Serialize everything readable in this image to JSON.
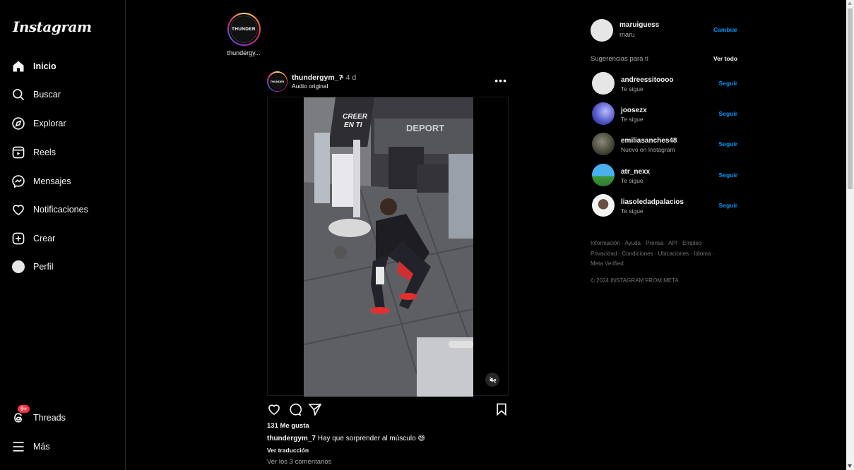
{
  "app": {
    "logo": "Instagram"
  },
  "sidebar": {
    "items": [
      {
        "label": "Inicio",
        "icon": "home-icon"
      },
      {
        "label": "Buscar",
        "icon": "search-icon"
      },
      {
        "label": "Explorar",
        "icon": "compass-icon"
      },
      {
        "label": "Reels",
        "icon": "reels-icon"
      },
      {
        "label": "Mensajes",
        "icon": "messenger-icon"
      },
      {
        "label": "Notificaciones",
        "icon": "heart-icon"
      },
      {
        "label": "Crear",
        "icon": "plus-square-icon"
      },
      {
        "label": "Perfil",
        "icon": "avatar"
      }
    ],
    "threads": {
      "label": "Threads",
      "icon": "threads-icon",
      "badge": "9+"
    },
    "more": {
      "label": "Más",
      "icon": "hamburger-icon"
    }
  },
  "story": {
    "username": "thundergy...",
    "logo_text": "THUNDER"
  },
  "post": {
    "username": "thundergym_7",
    "time": "• 4 d",
    "audio": "Audio original",
    "more": "•••",
    "avatar_text": "THUNDER",
    "likes": "131 Me gusta",
    "caption_user": "thundergym_7",
    "caption_text": "Hay que sorprender al músculo 😅",
    "translate": "Ver traducción",
    "comments": "Ver los 3 comentarios",
    "video_sign_1": "CREER",
    "video_sign_2": "EN TI",
    "video_sign_3": "DEPORT"
  },
  "right": {
    "me": {
      "username": "maruiguess",
      "name": "maru",
      "switch": "Cambiar"
    },
    "suggestions_title": "Sugerencias para ti",
    "see_all": "Ver todo",
    "suggestions": [
      {
        "username": "andreessitoooo",
        "sub": "Te sigue",
        "action": "Seguir",
        "avatar_color": "#e6e6e6"
      },
      {
        "username": "joosezx",
        "sub": "Te sigue",
        "action": "Seguir",
        "avatar_color": "#5a5fd0"
      },
      {
        "username": "emiliasanches48",
        "sub": "Nuevo en Instagram",
        "action": "Seguir",
        "avatar_color": "#4a4a3a"
      },
      {
        "username": "atr_nexx",
        "sub": "Te sigue",
        "action": "Seguir",
        "avatar_color": "#3aa0d8"
      },
      {
        "username": "liasoledadpalacios",
        "sub": "Te sigue",
        "action": "Seguir",
        "avatar_color": "#f0f0f0"
      }
    ],
    "footer_line1": "Información · Ayuda · Prensa · API · Empleo ·",
    "footer_line2": "Privacidad · Condiciones · Ubicaciones · Idioma ·",
    "footer_line3": "Meta Verified",
    "copyright": "© 2024 INSTAGRAM FROM META"
  },
  "colors": {
    "accent": "#0095f6",
    "badge": "#ff3040",
    "background": "#000000",
    "muted": "#a8a8a8"
  }
}
